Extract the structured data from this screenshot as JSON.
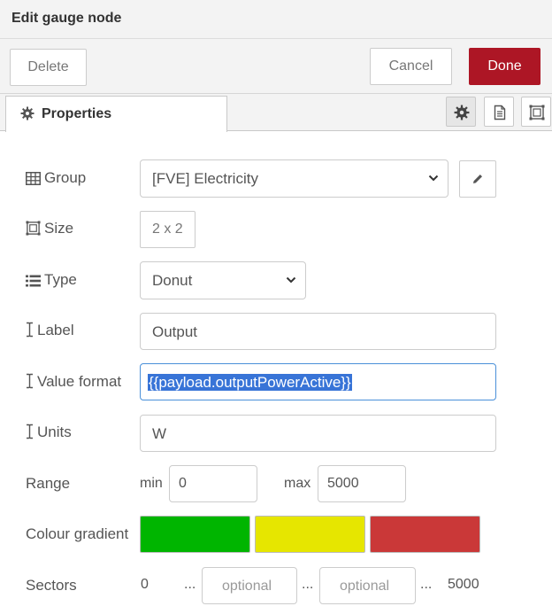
{
  "dialog": {
    "title": "Edit gauge node"
  },
  "actions": {
    "delete_label": "Delete",
    "cancel_label": "Cancel",
    "done_label": "Done",
    "done_color": "#ad1625"
  },
  "tabs": {
    "properties_label": "Properties",
    "icon_tabs": [
      "gear-icon",
      "document-icon",
      "frame-icon"
    ]
  },
  "form": {
    "group": {
      "label": "Group",
      "value": "[FVE] Electricity"
    },
    "size": {
      "label": "Size",
      "value": "2 x 2"
    },
    "type": {
      "label": "Type",
      "value": "Donut"
    },
    "label": {
      "label": "Label",
      "value": "Output"
    },
    "value_format": {
      "label": "Value format",
      "value": "{{payload.outputPowerActive}}"
    },
    "units": {
      "label": "Units",
      "value": "W"
    },
    "range": {
      "label": "Range",
      "min_label": "min",
      "min_value": "0",
      "max_label": "max",
      "max_value": "5000"
    },
    "colour_gradient": {
      "label": "Colour gradient",
      "colors": [
        "#00b500",
        "#e6e600",
        "#ca3838"
      ]
    },
    "sectors": {
      "label": "Sectors",
      "start": "0",
      "separator": "...",
      "placeholder_1": "optional",
      "placeholder_2": "optional",
      "end": "5000"
    }
  }
}
